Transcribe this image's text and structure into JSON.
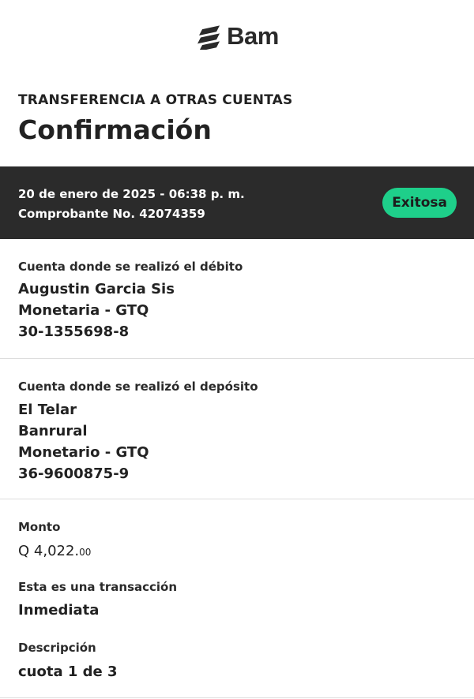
{
  "brand": {
    "name": "Bam"
  },
  "header": {
    "subtitle": "TRANSFERENCIA A OTRAS CUENTAS",
    "title": "Confirmación"
  },
  "status": {
    "datetime": "20 de enero de 2025 - 06:38 p. m.",
    "voucher": "Comprobante No. 42074359",
    "badge": "Exitosa",
    "badge_color": "#1ecf8a"
  },
  "debit": {
    "label": "Cuenta donde se realizó el débito",
    "name": "Augustin Garcia Sis",
    "type": "Monetaria - GTQ",
    "number": "30-1355698-8"
  },
  "deposit": {
    "label": "Cuenta donde se realizó el depósito",
    "name": "El Telar",
    "bank": "Banrural",
    "type": "Monetario - GTQ",
    "number": "36-9600875-9"
  },
  "amount": {
    "label": "Monto",
    "main": "Q 4,022.",
    "cents": "00"
  },
  "transaction": {
    "label": "Esta es una transacción",
    "value": "Inmediata"
  },
  "description": {
    "label": "Descripción",
    "value": "cuota 1 de 3"
  }
}
